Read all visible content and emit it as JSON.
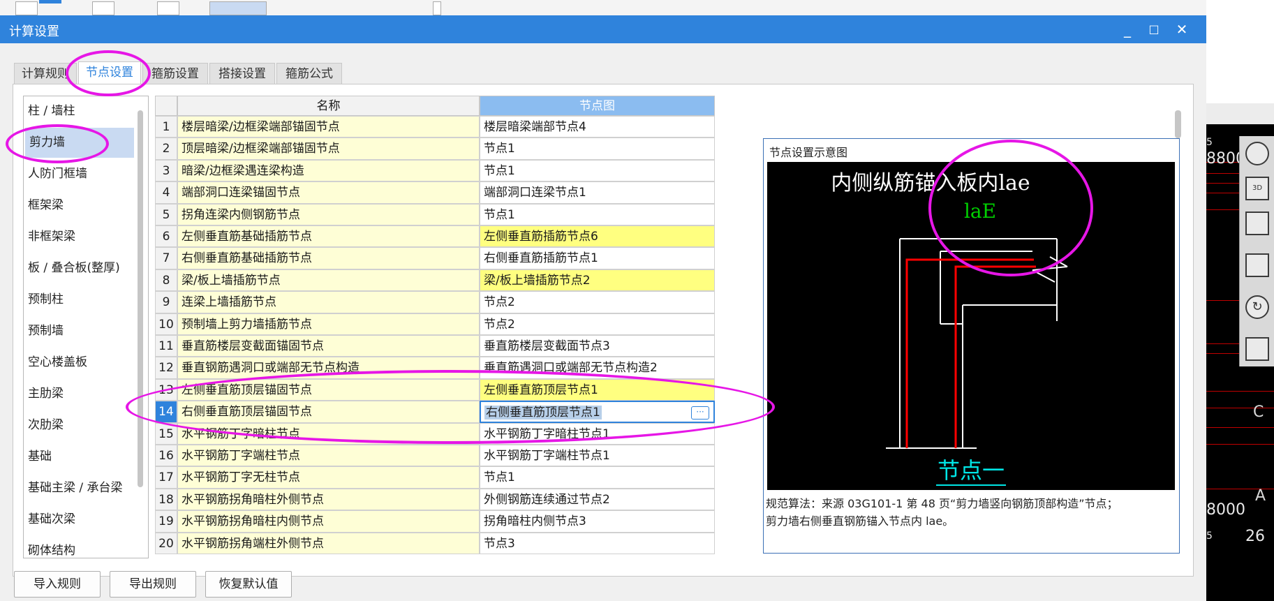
{
  "window": {
    "title": "计算设置",
    "minimize": "_",
    "maximize": "□",
    "close": "✕"
  },
  "tabs": [
    {
      "label": "计算规则",
      "active": false
    },
    {
      "label": "节点设置",
      "active": true
    },
    {
      "label": "箍筋设置",
      "active": false
    },
    {
      "label": "搭接设置",
      "active": false
    },
    {
      "label": "箍筋公式",
      "active": false
    }
  ],
  "categories": [
    {
      "label": "柱 / 墙柱",
      "selected": false
    },
    {
      "label": "剪力墙",
      "selected": true
    },
    {
      "label": "人防门框墙",
      "selected": false
    },
    {
      "label": "框架梁",
      "selected": false
    },
    {
      "label": "非框架梁",
      "selected": false
    },
    {
      "label": "板 / 叠合板(整厚)",
      "selected": false
    },
    {
      "label": "预制柱",
      "selected": false
    },
    {
      "label": "预制墙",
      "selected": false
    },
    {
      "label": "空心楼盖板",
      "selected": false
    },
    {
      "label": "主肋梁",
      "selected": false
    },
    {
      "label": "次肋梁",
      "selected": false
    },
    {
      "label": "基础",
      "selected": false
    },
    {
      "label": "基础主梁 / 承台梁",
      "selected": false
    },
    {
      "label": "基础次梁",
      "selected": false
    },
    {
      "label": "砌体结构",
      "selected": false
    }
  ],
  "grid": {
    "headers": {
      "name": "名称",
      "node": "节点图"
    },
    "rows": [
      {
        "num": "1",
        "name": "楼层暗梁/边框梁端部锚固节点",
        "node": "楼层暗梁端部节点4",
        "highlight": false
      },
      {
        "num": "2",
        "name": "顶层暗梁/边框梁端部锚固节点",
        "node": "节点1",
        "highlight": false
      },
      {
        "num": "3",
        "name": "暗梁/边框梁遇连梁构造",
        "node": "节点1",
        "highlight": false
      },
      {
        "num": "4",
        "name": "端部洞口连梁锚固节点",
        "node": "端部洞口连梁节点1",
        "highlight": false
      },
      {
        "num": "5",
        "name": "拐角连梁内侧钢筋节点",
        "node": "节点1",
        "highlight": false
      },
      {
        "num": "6",
        "name": "左侧垂直筋基础插筋节点",
        "node": "左侧垂直筋插筋节点6",
        "highlight": true
      },
      {
        "num": "7",
        "name": "右侧垂直筋基础插筋节点",
        "node": "右侧垂直筋插筋节点1",
        "highlight": false
      },
      {
        "num": "8",
        "name": "梁/板上墙插筋节点",
        "node": "梁/板上墙插筋节点2",
        "highlight": true
      },
      {
        "num": "9",
        "name": "连梁上墙插筋节点",
        "node": "节点2",
        "highlight": false
      },
      {
        "num": "10",
        "name": "预制墙上剪力墙插筋节点",
        "node": "节点2",
        "highlight": false
      },
      {
        "num": "11",
        "name": "垂直筋楼层变截面锚固节点",
        "node": "垂直筋楼层变截面节点3",
        "highlight": false
      },
      {
        "num": "12",
        "name": "垂直钢筋遇洞口或端部无节点构造",
        "node": "垂直筋遇洞口或端部无节点构造2",
        "highlight": false
      },
      {
        "num": "13",
        "name": "左侧垂直筋顶层锚固节点",
        "node": "左侧垂直筋顶层节点1",
        "highlight": true
      },
      {
        "num": "14",
        "name": "右侧垂直筋顶层锚固节点",
        "node": "右侧垂直筋顶层节点1",
        "highlight": false,
        "selected": true
      },
      {
        "num": "15",
        "name": "水平钢筋丁字暗柱节点",
        "node": "水平钢筋丁字暗柱节点1",
        "highlight": false
      },
      {
        "num": "16",
        "name": "水平钢筋丁字端柱节点",
        "node": "水平钢筋丁字端柱节点1",
        "highlight": false
      },
      {
        "num": "17",
        "name": "水平钢筋丁字无柱节点",
        "node": "节点1",
        "highlight": false
      },
      {
        "num": "18",
        "name": "水平钢筋拐角暗柱外侧节点",
        "node": "外侧钢筋连续通过节点2",
        "highlight": false
      },
      {
        "num": "19",
        "name": "水平钢筋拐角暗柱内侧节点",
        "node": "拐角暗柱内侧节点3",
        "highlight": false
      },
      {
        "num": "20",
        "name": "水平钢筋拐角端柱外侧节点",
        "node": "节点3",
        "highlight": false
      }
    ],
    "edit_button": "···"
  },
  "preview": {
    "title": "节点设置示意图",
    "diagram_heading": "内侧纵筋锚入板内lae",
    "diagram_label": "laE",
    "diagram_node_name": "节点一",
    "description_line1": "规范算法：来源 03G101-1 第 48 页“剪力墙竖向钢筋顶部构造”节点；",
    "description_line2": "剪力墙右侧垂直钢筋锚入节点内 lae。"
  },
  "buttons": {
    "import": "导入规则",
    "export": "导出规则",
    "restore": "恢复默认值"
  },
  "background": {
    "t1": "8800",
    "t2": "8000",
    "t3": "26",
    "t4": "C",
    "t5": "A",
    "t6": "5",
    "t7": "5",
    "t8": "3D"
  },
  "colors": {
    "accent": "#2f83dc",
    "highlight_ring": "#e616e6",
    "rebar_red": "#ff0000",
    "cell_yellow": "#ffff80"
  }
}
